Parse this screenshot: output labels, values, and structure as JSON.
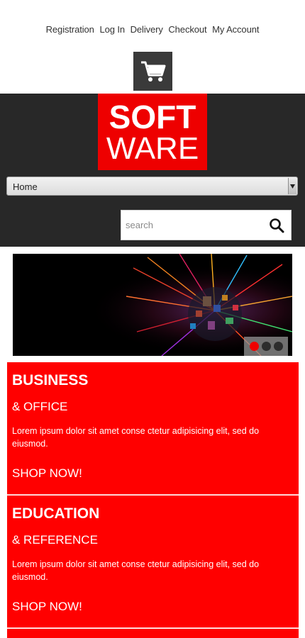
{
  "top_nav": [
    "Registration",
    "Log In",
    "Delivery",
    "Checkout",
    "My Account"
  ],
  "cart": {
    "icon": "shopping-cart-icon"
  },
  "logo": {
    "line1": "SOFT",
    "line2": "WARE"
  },
  "menu": {
    "selected": "Home"
  },
  "search": {
    "placeholder": "search",
    "icon": "search-icon"
  },
  "banner": {
    "slides": 3,
    "active_slide": 1
  },
  "promos": [
    {
      "title": "BUSINESS",
      "subtitle": "& OFFICE",
      "description": "Lorem ipsum dolor sit amet conse ctetur adipisicing elit, sed do eiusmod.",
      "cta": "SHOP NOW!"
    },
    {
      "title": "EDUCATION",
      "subtitle": "& REFERENCE",
      "description": "Lorem ipsum dolor sit amet conse ctetur adipisicing elit, sed do eiusmod.",
      "cta": "SHOP NOW!"
    }
  ],
  "colors": {
    "accent": "#ff0000",
    "header_bg": "#282828",
    "logo_bg": "#ee0000"
  }
}
